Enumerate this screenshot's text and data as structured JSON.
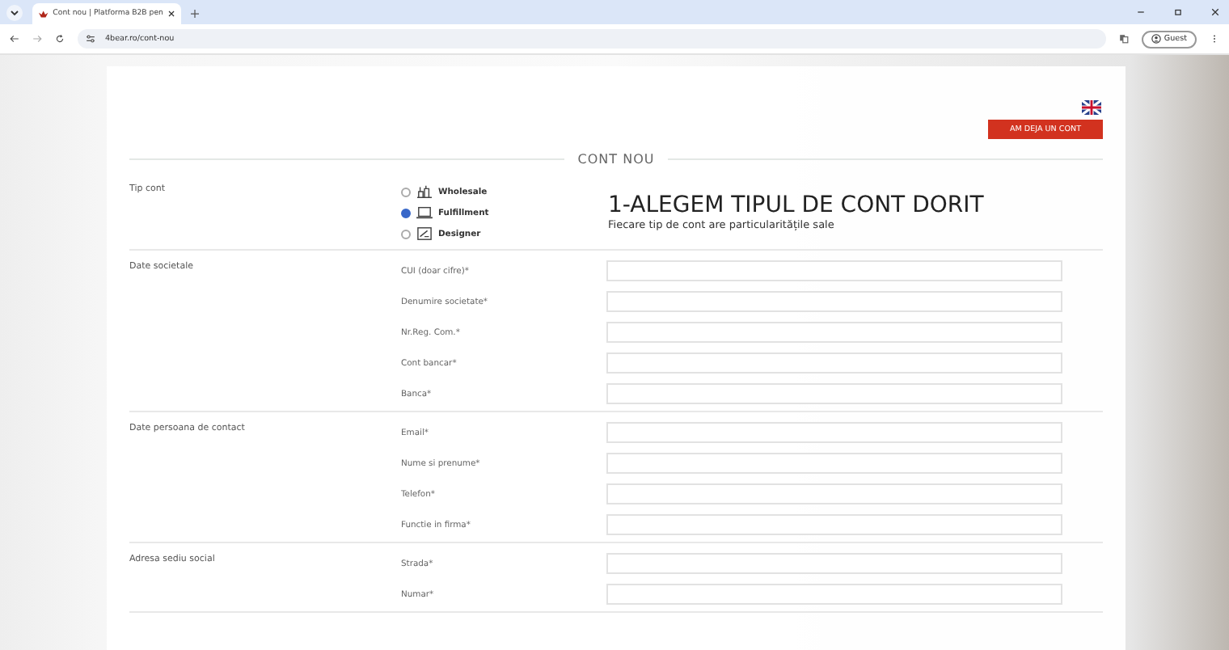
{
  "browser": {
    "tab_title": "Cont nou | Platforma B2B pen",
    "url": "4bear.ro/cont-nou",
    "profile_label": "Guest"
  },
  "page": {
    "login_button": "AM DEJA UN CONT",
    "title": "CONT NOU",
    "sections": [
      {
        "kind": "account_type",
        "label": "Tip cont",
        "heading": "1-ALEGEM TIPUL DE CONT DORIT",
        "subheading": "Fiecare tip de cont are particularitățile sale",
        "options": [
          {
            "label": "Wholesale",
            "selected": false
          },
          {
            "label": "Fulfillment",
            "selected": true
          },
          {
            "label": "Designer",
            "selected": false
          }
        ]
      },
      {
        "kind": "fields",
        "label": "Date societale",
        "fields": [
          {
            "label": "CUI (doar cifre)*"
          },
          {
            "label": "Denumire societate*"
          },
          {
            "label": "Nr.Reg. Com.*"
          },
          {
            "label": "Cont bancar*"
          },
          {
            "label": "Banca*"
          }
        ]
      },
      {
        "kind": "fields",
        "label": "Date persoana de contact",
        "fields": [
          {
            "label": "Email*"
          },
          {
            "label": "Nume si prenume*"
          },
          {
            "label": "Telefon*"
          },
          {
            "label": "Functie in firma*"
          }
        ]
      },
      {
        "kind": "fields",
        "label": "Adresa sediu social",
        "fields": [
          {
            "label": "Strada*"
          },
          {
            "label": "Numar*"
          }
        ]
      }
    ]
  }
}
